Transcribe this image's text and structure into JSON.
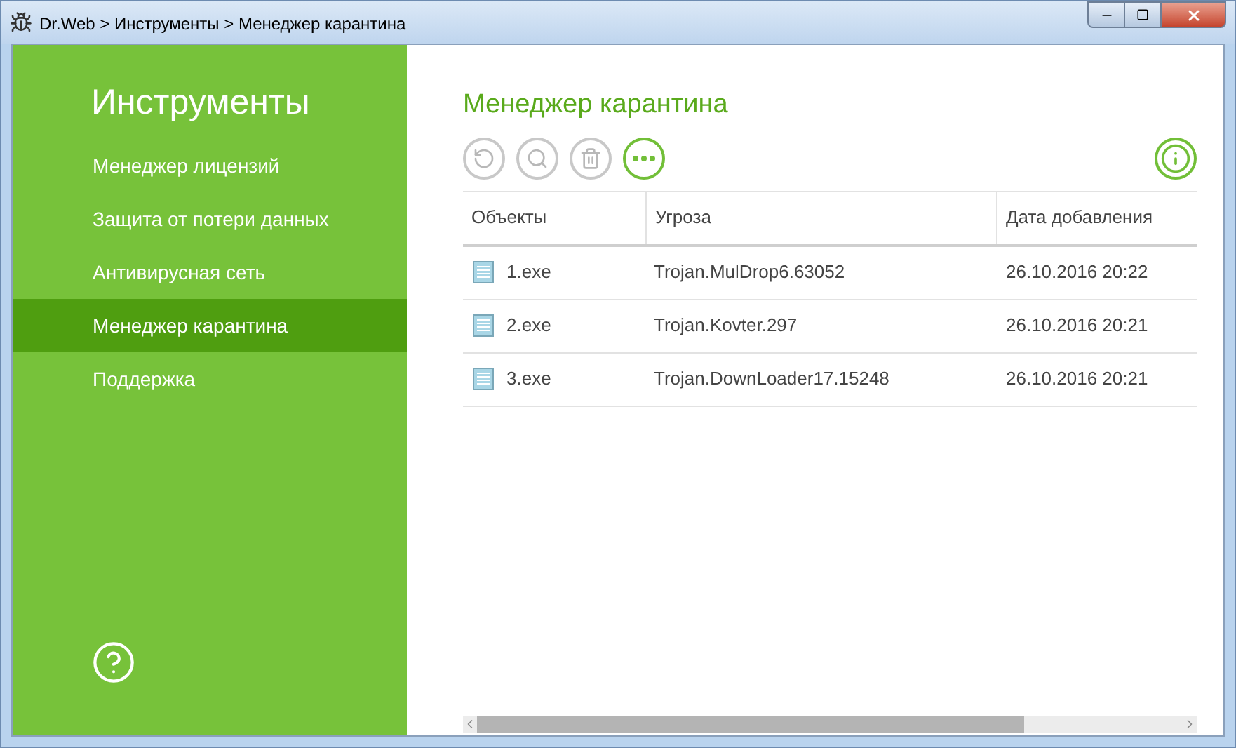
{
  "window": {
    "title": "Dr.Web > Инструменты > Менеджер карантина"
  },
  "sidebar": {
    "title": "Инструменты",
    "items": [
      {
        "label": "Менеджер лицензий",
        "selected": false
      },
      {
        "label": "Защита от потери данных",
        "selected": false
      },
      {
        "label": "Антивирусная сеть",
        "selected": false
      },
      {
        "label": "Менеджер карантина",
        "selected": true
      },
      {
        "label": "Поддержка",
        "selected": false
      }
    ]
  },
  "page": {
    "title": "Менеджер карантина"
  },
  "toolbar": [
    {
      "kind": "restore",
      "disabled": true
    },
    {
      "kind": "scan",
      "disabled": true
    },
    {
      "kind": "delete",
      "disabled": true
    },
    {
      "kind": "more",
      "disabled": false
    }
  ],
  "table": {
    "columns": [
      "Объекты",
      "Угроза",
      "Дата добавления"
    ],
    "rows": [
      {
        "object": "1.exe",
        "threat": "Trojan.MulDrop6.63052",
        "date": "26.10.2016 20:22"
      },
      {
        "object": "2.exe",
        "threat": "Trojan.Kovter.297",
        "date": "26.10.2016 20:21"
      },
      {
        "object": "3.exe",
        "threat": "Trojan.DownLoader17.15248",
        "date": "26.10.2016 20:21"
      }
    ]
  }
}
